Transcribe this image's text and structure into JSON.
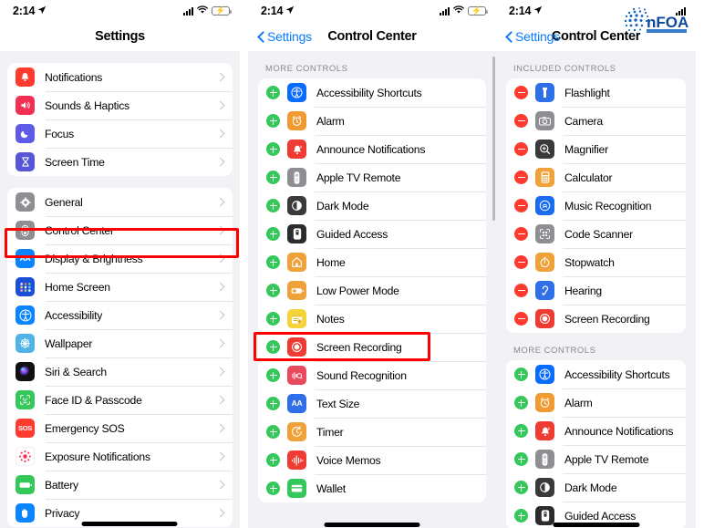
{
  "status_bar": {
    "time": "2:14",
    "location_icon": "location-arrow-icon",
    "cellular_icon": "cellular-bars-icon",
    "wifi_icon": "wifi-icon",
    "battery_icon": "battery-charging-icon"
  },
  "watermark": {
    "text": "nFOA",
    "subtext": "",
    "color": "#1565c0"
  },
  "panel1": {
    "nav_title": "Settings",
    "groups": [
      {
        "rows": [
          {
            "label": "Notifications",
            "icon": "notifications-icon",
            "color": "#ff3b30"
          },
          {
            "label": "Sounds & Haptics",
            "icon": "sounds-haptics-icon",
            "color": "#f42f54"
          },
          {
            "label": "Focus",
            "icon": "focus-icon",
            "color": "#5e5ce6"
          },
          {
            "label": "Screen Time",
            "icon": "screen-time-icon",
            "color": "#5856d6"
          }
        ]
      },
      {
        "rows": [
          {
            "label": "General",
            "icon": "general-gear-icon",
            "color": "#8e8e93"
          },
          {
            "label": "Control Center",
            "icon": "control-center-icon",
            "color": "#8e8e93"
          },
          {
            "label": "Display & Brightness",
            "icon": "display-brightness-icon",
            "color": "#0a84ff"
          },
          {
            "label": "Home Screen",
            "icon": "home-screen-icon",
            "color": "#1c4fd8"
          },
          {
            "label": "Accessibility",
            "icon": "accessibility-icon",
            "color": "#0a84ff"
          },
          {
            "label": "Wallpaper",
            "icon": "wallpaper-icon",
            "color": "#4fb3e8"
          },
          {
            "label": "Siri & Search",
            "icon": "siri-search-icon",
            "color": "#1c1c1e"
          },
          {
            "label": "Face ID & Passcode",
            "icon": "face-id-icon",
            "color": "#34c759"
          },
          {
            "label": "Emergency SOS",
            "icon": "emergency-sos-icon",
            "color": "#ff3b30"
          },
          {
            "label": "Exposure Notifications",
            "icon": "exposure-notifications-icon",
            "color": "#ffffff"
          },
          {
            "label": "Battery",
            "icon": "battery-icon",
            "color": "#34c759"
          },
          {
            "label": "Privacy",
            "icon": "privacy-hand-icon",
            "color": "#0a84ff"
          }
        ]
      }
    ],
    "highlight": {
      "target": "Control Center",
      "color": "#ff0000"
    }
  },
  "panel2": {
    "nav_back": "Settings",
    "nav_title": "Control Center",
    "section_header": "MORE CONTROLS",
    "rows": [
      {
        "label": "Accessibility Shortcuts",
        "action": "add",
        "icon": "accessibility-icon",
        "color": "#0a6cff"
      },
      {
        "label": "Alarm",
        "action": "add",
        "icon": "alarm-icon",
        "color": "#f09a31"
      },
      {
        "label": "Announce Notifications",
        "action": "add",
        "icon": "announce-notifications-icon",
        "color": "#ee3b33"
      },
      {
        "label": "Apple TV Remote",
        "action": "add",
        "icon": "apple-tv-remote-icon",
        "color": "#8e8e93"
      },
      {
        "label": "Dark Mode",
        "action": "add",
        "icon": "dark-mode-icon",
        "color": "#3a3a3c"
      },
      {
        "label": "Guided Access",
        "action": "add",
        "icon": "guided-access-icon",
        "color": "#2c2c2e"
      },
      {
        "label": "Home",
        "action": "add",
        "icon": "home-icon",
        "color": "#f0a23a"
      },
      {
        "label": "Low Power Mode",
        "action": "add",
        "icon": "low-power-mode-icon",
        "color": "#f0a23a"
      },
      {
        "label": "Notes",
        "action": "add",
        "icon": "notes-icon",
        "color": "#f5d43a"
      },
      {
        "label": "Screen Recording",
        "action": "add",
        "icon": "screen-recording-icon",
        "color": "#ee3b33"
      },
      {
        "label": "Sound Recognition",
        "action": "add",
        "icon": "sound-recognition-icon",
        "color": "#e8495c"
      },
      {
        "label": "Text Size",
        "action": "add",
        "icon": "text-size-icon",
        "color": "#2f6fe8"
      },
      {
        "label": "Timer",
        "action": "add",
        "icon": "timer-icon",
        "color": "#f0a23a"
      },
      {
        "label": "Voice Memos",
        "action": "add",
        "icon": "voice-memos-icon",
        "color": "#ee3b33"
      },
      {
        "label": "Wallet",
        "action": "add",
        "icon": "wallet-icon",
        "color": "#34c759"
      }
    ],
    "highlight": {
      "target": "Screen Recording",
      "color": "#ff0000"
    }
  },
  "panel3": {
    "nav_back": "Settings",
    "nav_title": "Control Center",
    "section_included_header": "INCLUDED CONTROLS",
    "included_rows": [
      {
        "label": "Flashlight",
        "action": "remove",
        "icon": "flashlight-icon",
        "color": "#2f6fe8"
      },
      {
        "label": "Camera",
        "action": "remove",
        "icon": "camera-icon",
        "color": "#8e8e93"
      },
      {
        "label": "Magnifier",
        "action": "remove",
        "icon": "magnifier-icon",
        "color": "#3a3a3c"
      },
      {
        "label": "Calculator",
        "action": "remove",
        "icon": "calculator-icon",
        "color": "#f0a23a"
      },
      {
        "label": "Music Recognition",
        "action": "remove",
        "icon": "music-recognition-icon",
        "color": "#1a6df0"
      },
      {
        "label": "Code Scanner",
        "action": "remove",
        "icon": "code-scanner-icon",
        "color": "#8e8e93"
      },
      {
        "label": "Stopwatch",
        "action": "remove",
        "icon": "stopwatch-icon",
        "color": "#f0a23a"
      },
      {
        "label": "Hearing",
        "action": "remove",
        "icon": "hearing-icon",
        "color": "#2f6fe8"
      },
      {
        "label": "Screen Recording",
        "action": "remove",
        "icon": "screen-recording-icon",
        "color": "#ee3b33"
      }
    ],
    "section_more_header": "MORE CONTROLS",
    "more_rows": [
      {
        "label": "Accessibility Shortcuts",
        "action": "add",
        "icon": "accessibility-icon",
        "color": "#0a6cff"
      },
      {
        "label": "Alarm",
        "action": "add",
        "icon": "alarm-icon",
        "color": "#f09a31"
      },
      {
        "label": "Announce Notifications",
        "action": "add",
        "icon": "announce-notifications-icon",
        "color": "#ee3b33"
      },
      {
        "label": "Apple TV Remote",
        "action": "add",
        "icon": "apple-tv-remote-icon",
        "color": "#8e8e93"
      },
      {
        "label": "Dark Mode",
        "action": "add",
        "icon": "dark-mode-icon",
        "color": "#3a3a3c"
      },
      {
        "label": "Guided Access",
        "action": "add",
        "icon": "guided-access-icon",
        "color": "#2c2c2e"
      }
    ]
  }
}
